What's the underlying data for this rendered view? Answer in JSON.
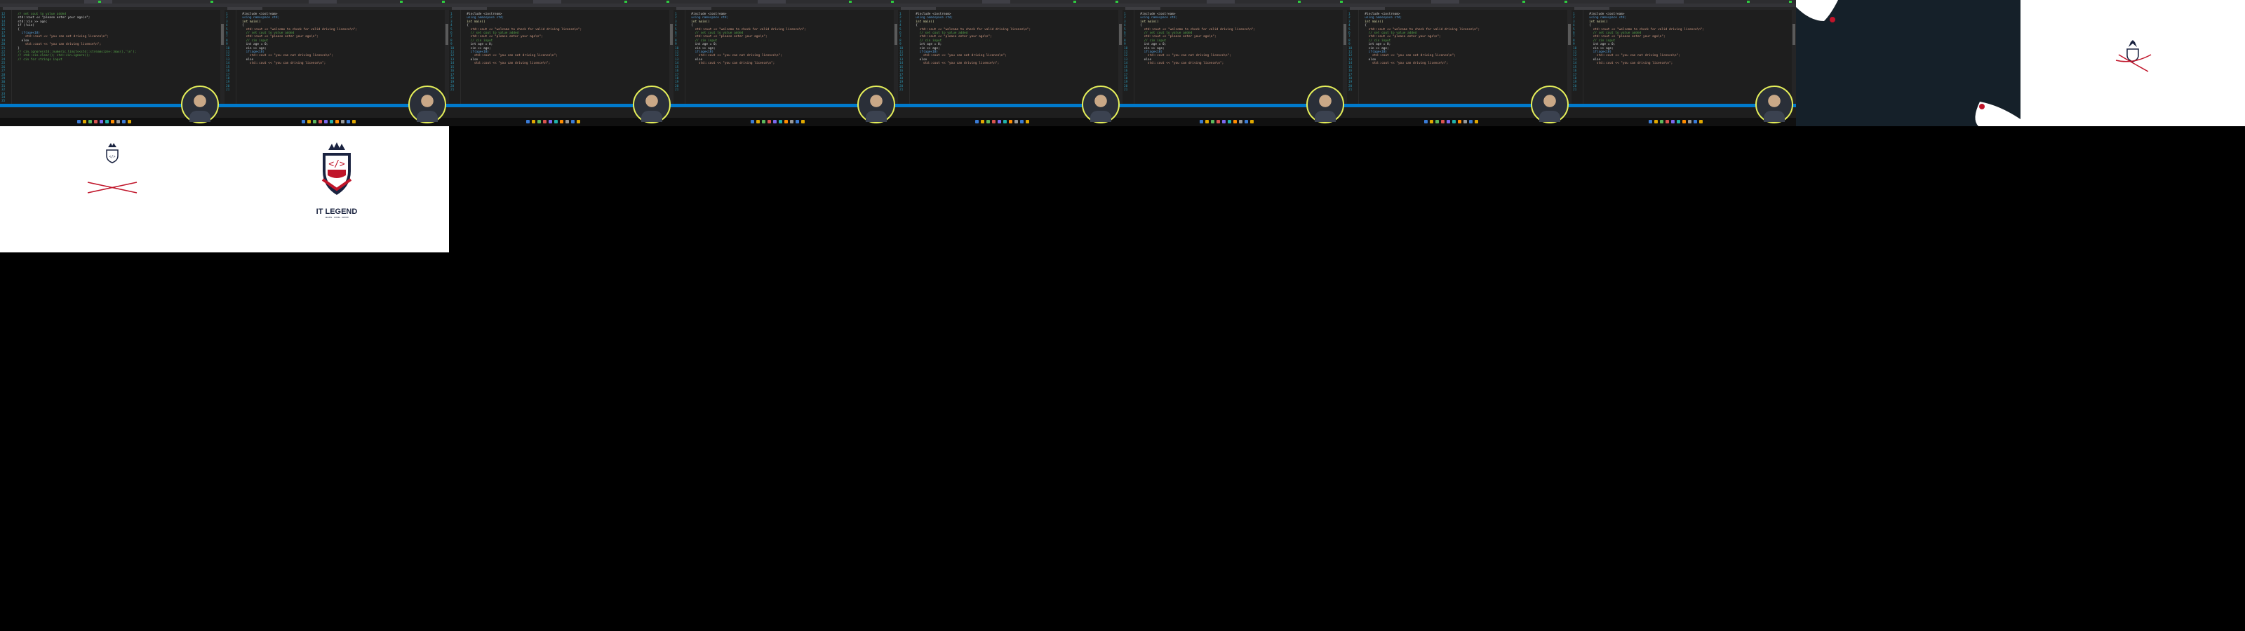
{
  "frames": [
    {
      "id": "frame-1",
      "line_numbers": "12\n13\n14\n15\n16\n17\n18\n19\n20\n21\n22\n23\n24\n25\n26\n27\n28\n29\n30\n31\n32\n33\n34\n35",
      "code_lines": [
        {
          "cls": "c",
          "text": "  // set cout to value added"
        },
        {
          "cls": "",
          "text": "  std::cout << \"please enter your age\\n\";"
        },
        {
          "cls": "",
          "text": "  std::cin >> age;"
        },
        {
          "cls": "",
          "text": "  if (!cin)"
        },
        {
          "cls": "",
          "text": "  {"
        },
        {
          "cls": "k",
          "text": "    if(age<18)"
        },
        {
          "cls": "s",
          "text": "      std::cout << \"you can not driving licence\\n\";"
        },
        {
          "cls": "",
          "text": "    else"
        },
        {
          "cls": "s",
          "text": "      std::cout << \"you can driving licence\\n\";"
        },
        {
          "cls": "",
          "text": "  }"
        },
        {
          "cls": "",
          "text": ""
        },
        {
          "cls": "",
          "text": ""
        },
        {
          "cls": "c",
          "text": "  // cin.ignore(std::numeric_limits<std::streamsize>::max(),'\\n');"
        },
        {
          "cls": "c",
          "text": "  // std::cin.clear(); std::cin.ignore();"
        },
        {
          "cls": "",
          "text": ""
        },
        {
          "cls": "c",
          "text": "  // cin for strings input"
        }
      ]
    },
    {
      "id": "frame-2",
      "line_numbers": "1\n2\n3\n4\n5\n6\n7\n8\n9\n10\n11\n12\n13\n14\n15\n16\n17\n18\n19\n20\n21",
      "code_lines": [
        {
          "cls": "",
          "text": "  #include <iostream>"
        },
        {
          "cls": "k",
          "text": "  using namespace std;"
        },
        {
          "cls": "y",
          "text": "  int main()"
        },
        {
          "cls": "",
          "text": "  {"
        },
        {
          "cls": "s",
          "text": "    std::cout << \"welcome to check for valid driving licence\\n\";"
        },
        {
          "cls": "",
          "text": ""
        },
        {
          "cls": "c",
          "text": "    // set cout to value added"
        },
        {
          "cls": "s",
          "text": "    std::cout << \"please enter your age\\n\";"
        },
        {
          "cls": "c",
          "text": "    // cin input"
        },
        {
          "cls": "",
          "text": "    int age = 0;"
        },
        {
          "cls": "",
          "text": "    cin >> age;"
        },
        {
          "cls": "",
          "text": ""
        },
        {
          "cls": "k",
          "text": "    if(age<18)"
        },
        {
          "cls": "s",
          "text": "      std::cout << \"you can not driving licence\\n\";"
        },
        {
          "cls": "",
          "text": "    else"
        },
        {
          "cls": "s",
          "text": "      std::cout << \"you can driving licence\\n\";"
        }
      ]
    }
  ],
  "brand": {
    "name": "IT LEGEND",
    "tagline": "LEARN · CODE · GROW",
    "code_glyph": "</>"
  }
}
